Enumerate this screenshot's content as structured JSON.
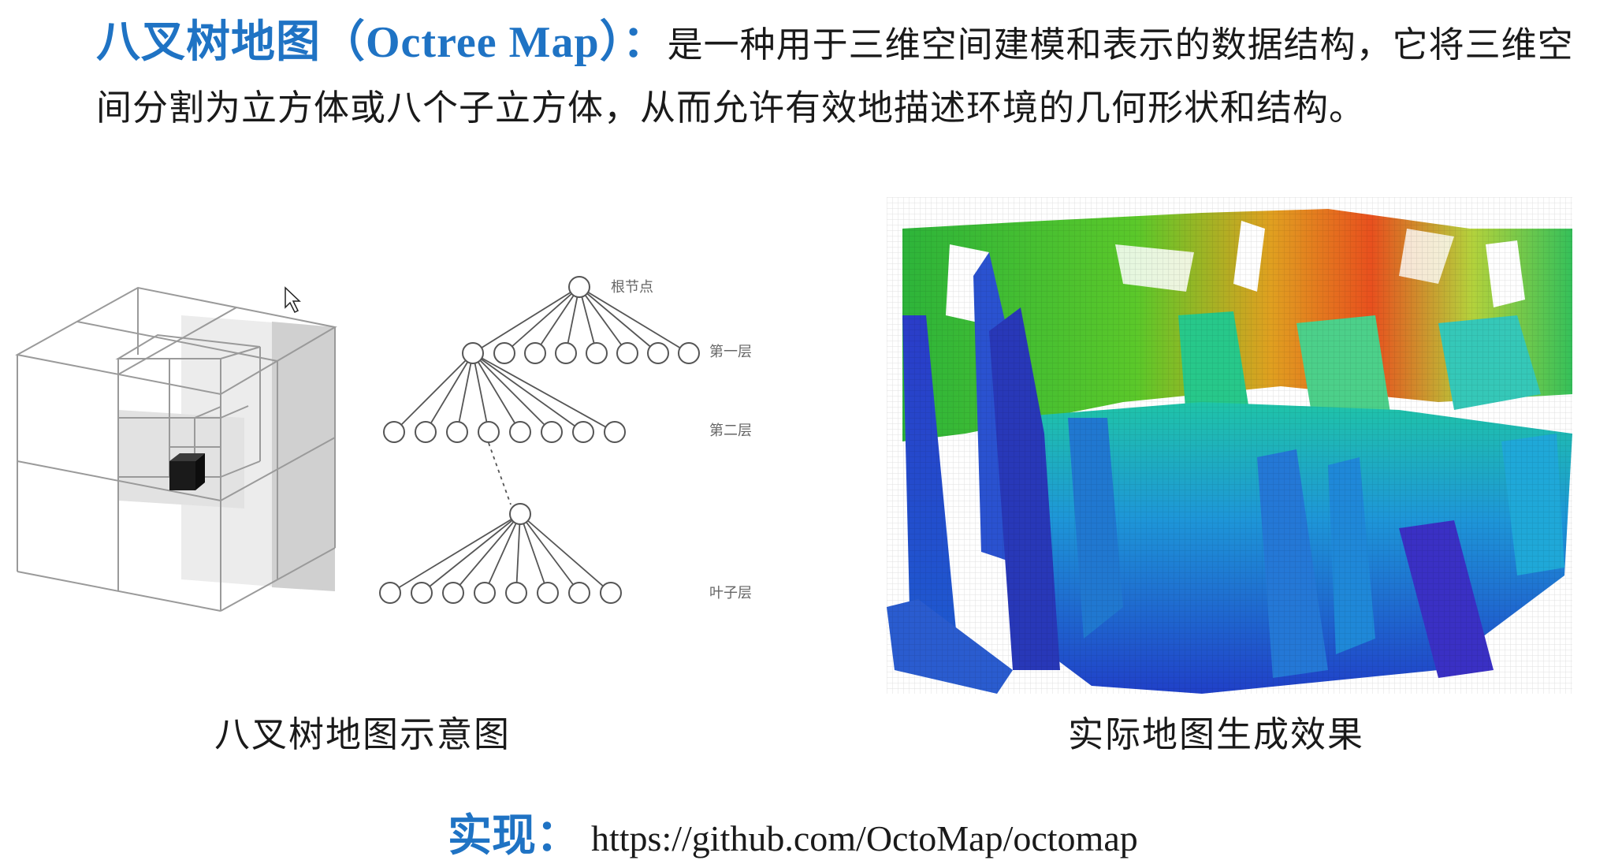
{
  "intro": {
    "term_cn": "八叉树地图",
    "paren_open": "（",
    "term_en": "Octree Map",
    "paren_close": "）",
    "colon": "：",
    "description": "是一种用于三维空间建模和表示的数据结构，它将三维空间分割为立方体或八个子立方体，从而允许有效地描述环境的几何形状和结构。"
  },
  "tree_diagram": {
    "labels": [
      "根节点",
      "第一层",
      "第二层",
      "叶子层"
    ]
  },
  "captions": {
    "left": "八叉树地图示意图",
    "right": "实际地图生成效果"
  },
  "implementation": {
    "label": "实现：",
    "url": "https://github.com/OctoMap/octomap"
  },
  "colors": {
    "accent": "#1f73c4",
    "text": "#1a1a1a"
  }
}
